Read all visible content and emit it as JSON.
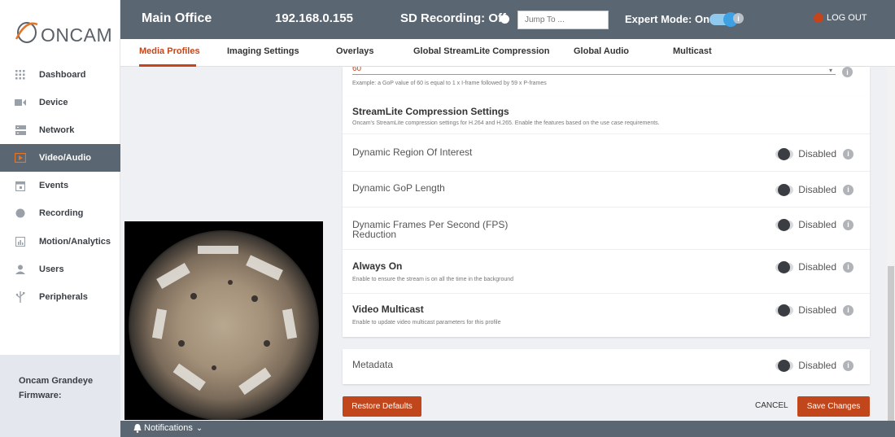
{
  "brand": {
    "logo_text": "ONCAM"
  },
  "sidebar": {
    "items": [
      {
        "label": "Dashboard",
        "icon": "grid-icon"
      },
      {
        "label": "Device",
        "icon": "camera-icon"
      },
      {
        "label": "Network",
        "icon": "network-icon"
      },
      {
        "label": "Video/Audio",
        "icon": "video-icon",
        "active": true
      },
      {
        "label": "Events",
        "icon": "calendar-icon"
      },
      {
        "label": "Recording",
        "icon": "record-icon"
      },
      {
        "label": "Motion/Analytics",
        "icon": "chart-icon"
      },
      {
        "label": "Users",
        "icon": "user-icon"
      },
      {
        "label": "Peripherals",
        "icon": "usb-icon"
      }
    ],
    "info": {
      "device": "Oncam Grandeye",
      "firmware_label": "Firmware:"
    }
  },
  "topbar": {
    "location": "Main Office",
    "ip": "192.168.0.155",
    "sd_recording": "SD Recording: Off",
    "jump_placeholder": "Jump To ...",
    "expert_mode": "Expert Mode: On",
    "logout": "LOG OUT"
  },
  "tabs": [
    "Media Profiles",
    "Imaging Settings",
    "Overlays",
    "Global StreamLite Compression",
    "Global Audio",
    "Multicast"
  ],
  "gop": {
    "value": "60",
    "example": "Example: a GoP value of 60 is equal to 1 x I-frame followed by 59 x P-frames"
  },
  "streamlite": {
    "title": "StreamLite Compression Settings",
    "desc": "Oncam's StreamLite compression settings for H.264 and H.265. Enable the features based on the use case requirements.",
    "rows": [
      {
        "title": "Dynamic Region Of Interest",
        "status": "Disabled"
      },
      {
        "title": "Dynamic GoP Length",
        "status": "Disabled"
      },
      {
        "title": "Dynamic Frames Per Second (FPS)",
        "title2": "Reduction",
        "status": "Disabled"
      }
    ]
  },
  "always_on": {
    "title": "Always On",
    "desc": "Enable to ensure the stream is on all the time in the background",
    "status": "Disabled"
  },
  "video_multicast": {
    "title": "Video Multicast",
    "desc": "Enable to update video multicast parameters for this profile",
    "status": "Disabled"
  },
  "metadata": {
    "title": "Metadata",
    "status": "Disabled"
  },
  "buttons": {
    "restore": "Restore Defaults",
    "cancel": "CANCEL",
    "save": "Save Changes"
  },
  "bottombar": {
    "notifications": "Notifications"
  },
  "colors": {
    "primary_dark": "#5a6672",
    "accent": "#c4451c",
    "toggle_on": "#3ea1e4"
  }
}
